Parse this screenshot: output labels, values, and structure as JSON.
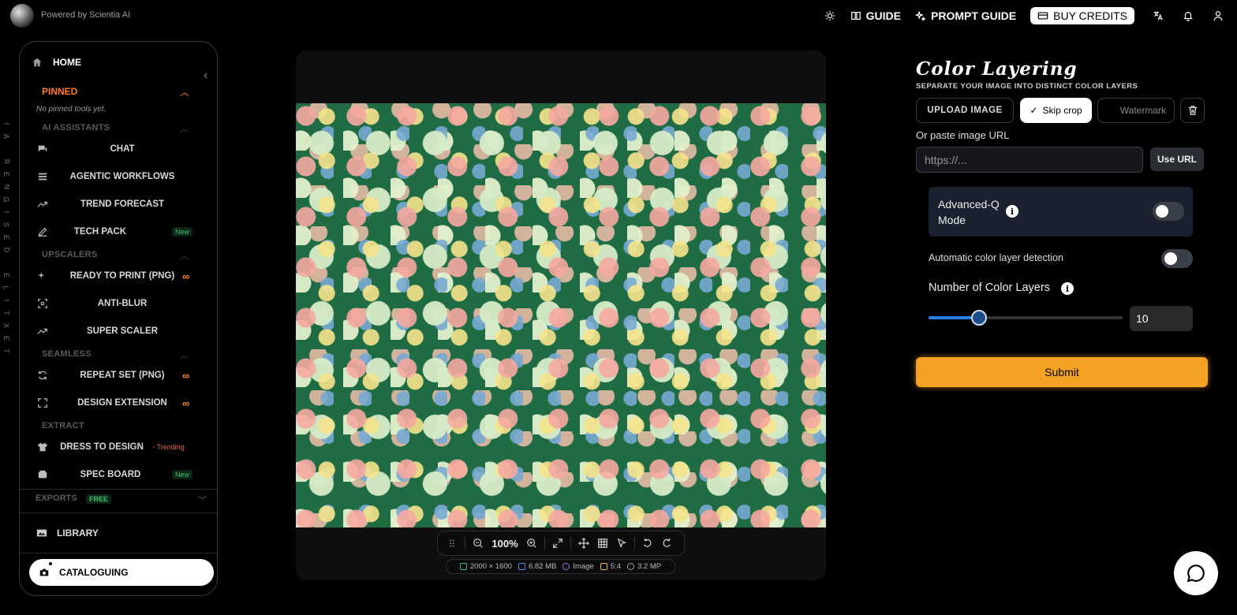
{
  "header": {
    "powered_by": "Powered by Scientia AI",
    "nav": [
      {
        "label": "GUIDE",
        "icon": "book-icon"
      },
      {
        "label": "PROMPT GUIDE",
        "icon": "sparkle-icon"
      },
      {
        "label": "BUY CREDITS",
        "icon": "card-icon"
      }
    ],
    "icons": [
      "sun-icon",
      "translate-icon",
      "bell-icon",
      "user-icon"
    ]
  },
  "side_text": [
    "T",
    "E",
    "X",
    "T",
    "I",
    "L",
    "E",
    " ",
    "D",
    "E",
    "S",
    "I",
    "G",
    "N",
    "E",
    "R",
    " ",
    "A",
    "I"
  ],
  "sidebar": {
    "home": "HOME",
    "pinned": "PINNED",
    "no_pinned": "No pinned tools yet.",
    "sections": {
      "ai_assistants": "AI ASSISTANTS",
      "upscalers": "UPSCALERS",
      "seamless": "SEAMLESS",
      "extract": "EXTRACT"
    },
    "items": [
      {
        "label": "CHAT",
        "icon": "chat-icon"
      },
      {
        "label": "AGENTIC WORKFLOWS",
        "icon": "stack-icon"
      },
      {
        "label": "TREND FORECAST",
        "icon": "trend-icon"
      },
      {
        "label": "TECH PACK",
        "icon": "edit-icon",
        "badge": "New"
      },
      {
        "label": "READY TO PRINT (PNG)",
        "icon": "sparkle-icon",
        "badge": "∞"
      },
      {
        "label": "ANTI-BLUR",
        "icon": "focus-icon"
      },
      {
        "label": "SUPER SCALER",
        "icon": "trend-icon"
      },
      {
        "label": "REPEAT SET (PNG)",
        "icon": "refresh-icon",
        "badge": "∞"
      },
      {
        "label": "DESIGN EXTENSION",
        "icon": "expand-icon",
        "badge": "∞"
      },
      {
        "label": "DRESS TO DESIGN",
        "icon": "shirt-icon",
        "badge": "Trending"
      },
      {
        "label": "SPEC BOARD",
        "icon": "board-icon",
        "badge": "New"
      }
    ],
    "exports": "EXPORTS",
    "exports_badge": "FREE",
    "library": "LIBRARY",
    "cataloguing": "CATALOGUING"
  },
  "canvas": {
    "zoom": "100%",
    "info": {
      "dimensions": "2000 × 1600",
      "size": "6.82 MB",
      "type": "Image",
      "ratio": "5:4",
      "megapixels": "3.2 MP"
    }
  },
  "panel": {
    "title": "Color Layering",
    "subtitle": "SEPARATE YOUR IMAGE INTO DISTINCT COLOR LAYERS",
    "upload": "UPLOAD IMAGE",
    "skip_crop": "Skip crop",
    "watermark": "Watermark",
    "url_label": "Or paste image URL",
    "url_placeholder": "https://...",
    "use_url": "Use URL",
    "advanced_mode": "Advanced-Q Mode",
    "advanced_on": false,
    "auto_detect": "Automatic color layer detection",
    "auto_on": false,
    "num_layers_label": "Number of Color Layers",
    "num_layers": "10",
    "slider_fraction": 0.26,
    "submit": "Submit"
  },
  "colors": {
    "accent_orange": "#f4a124",
    "pinned_orange": "#ff7a29",
    "slider_blue": "#2b7de9",
    "new_green": "#37c46b"
  }
}
